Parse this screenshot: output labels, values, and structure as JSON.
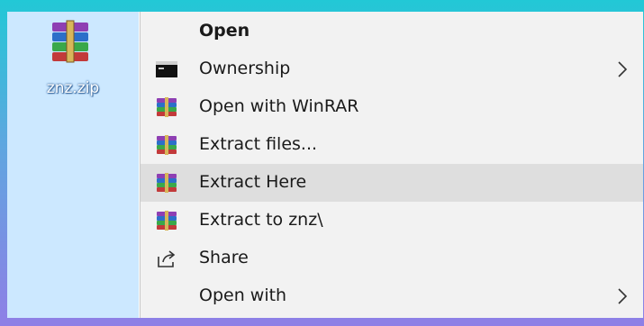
{
  "file": {
    "name": "znz.zip",
    "icon": "winrar-archive-icon"
  },
  "context_menu": {
    "items": [
      {
        "label": "Open",
        "bold": true,
        "icon": "",
        "submenu": false
      },
      {
        "label": "Ownership",
        "bold": false,
        "icon": "console-icon",
        "submenu": true
      },
      {
        "label": "Open with WinRAR",
        "bold": false,
        "icon": "winrar-icon",
        "submenu": false
      },
      {
        "label": "Extract files...",
        "bold": false,
        "icon": "winrar-icon",
        "submenu": false
      },
      {
        "label": "Extract Here",
        "bold": false,
        "icon": "winrar-icon",
        "submenu": false,
        "highlighted": true
      },
      {
        "label": "Extract to znz\\",
        "bold": false,
        "icon": "winrar-icon",
        "submenu": false
      },
      {
        "label": "Share",
        "bold": false,
        "icon": "share-icon",
        "submenu": false
      },
      {
        "label": "Open with",
        "bold": false,
        "icon": "",
        "submenu": true
      }
    ]
  },
  "colors": {
    "menu_bg": "#f2f2f2",
    "hover_bg": "#dedede",
    "selection_bg": "#cce8ff"
  }
}
